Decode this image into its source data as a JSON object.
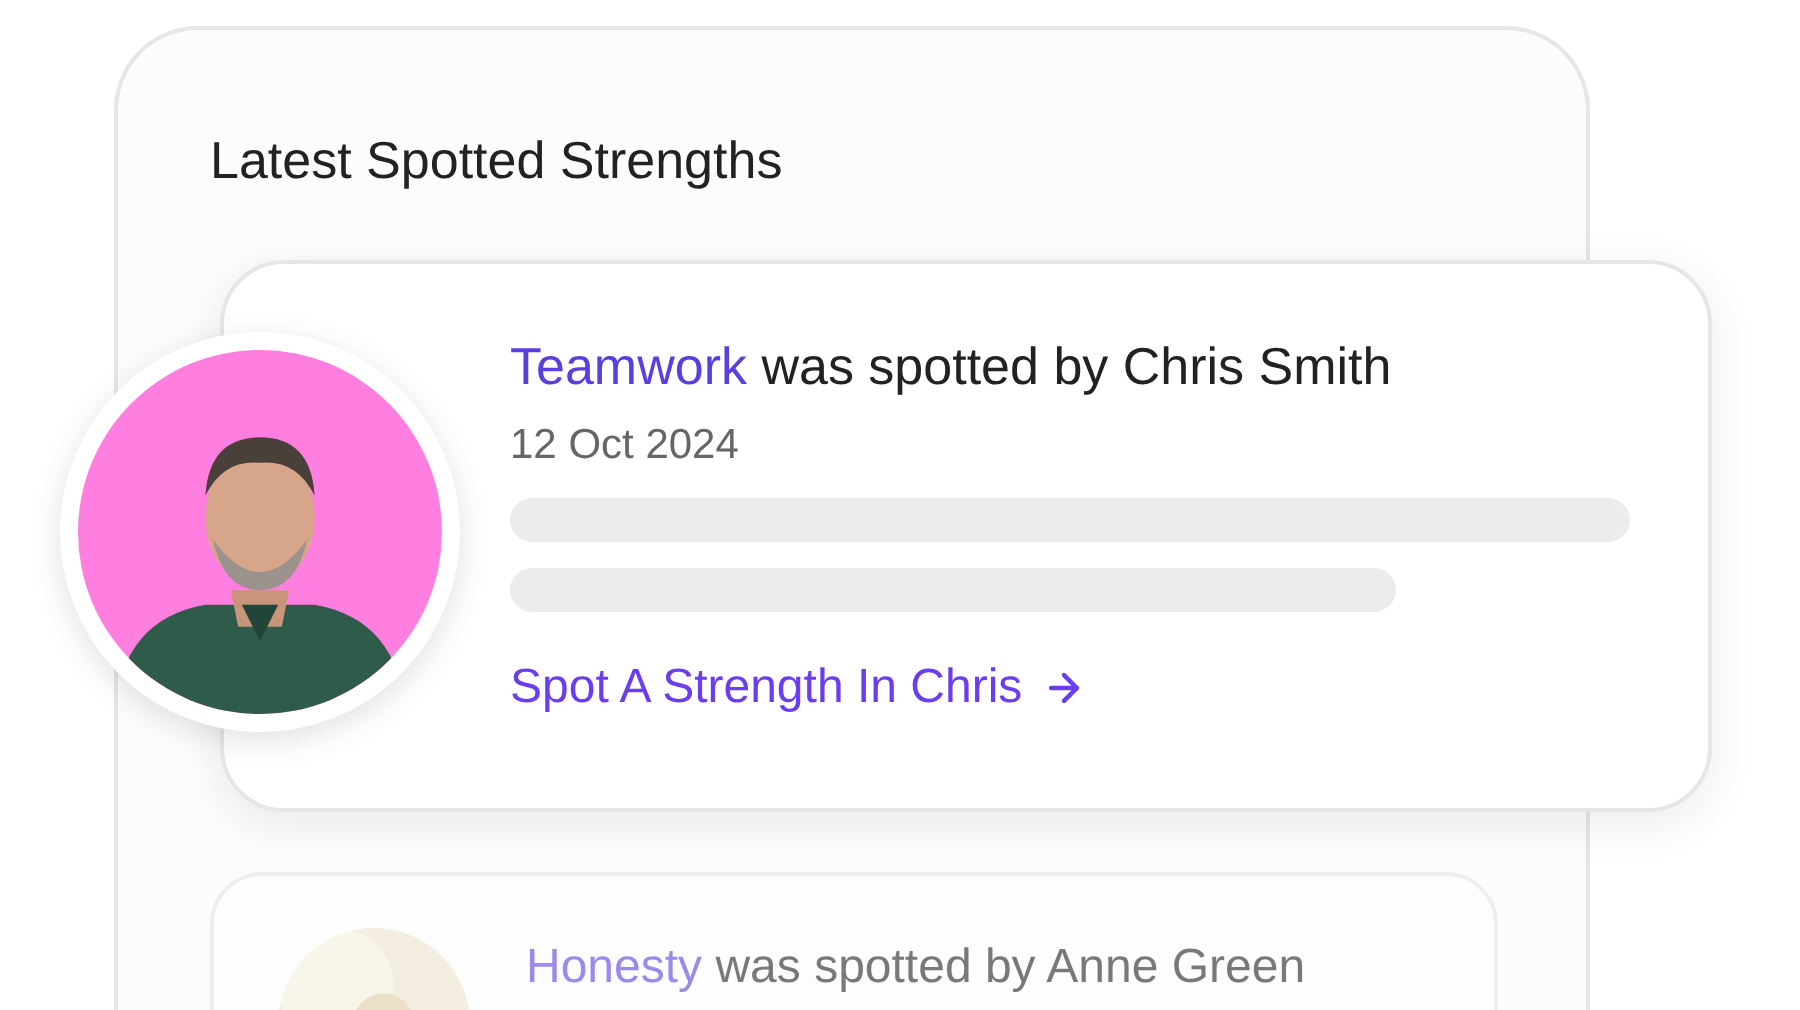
{
  "title": "Latest Spotted Strengths",
  "cards": [
    {
      "strength": "Teamwork",
      "spotted_by": "was spotted by Chris Smith",
      "date": "12 Oct 2024",
      "link": "Spot A Strength In Chris",
      "dimmed": false
    },
    {
      "strength": "Honesty",
      "spotted_by": "was spotted by Anne Green",
      "dimmed": true
    }
  ]
}
